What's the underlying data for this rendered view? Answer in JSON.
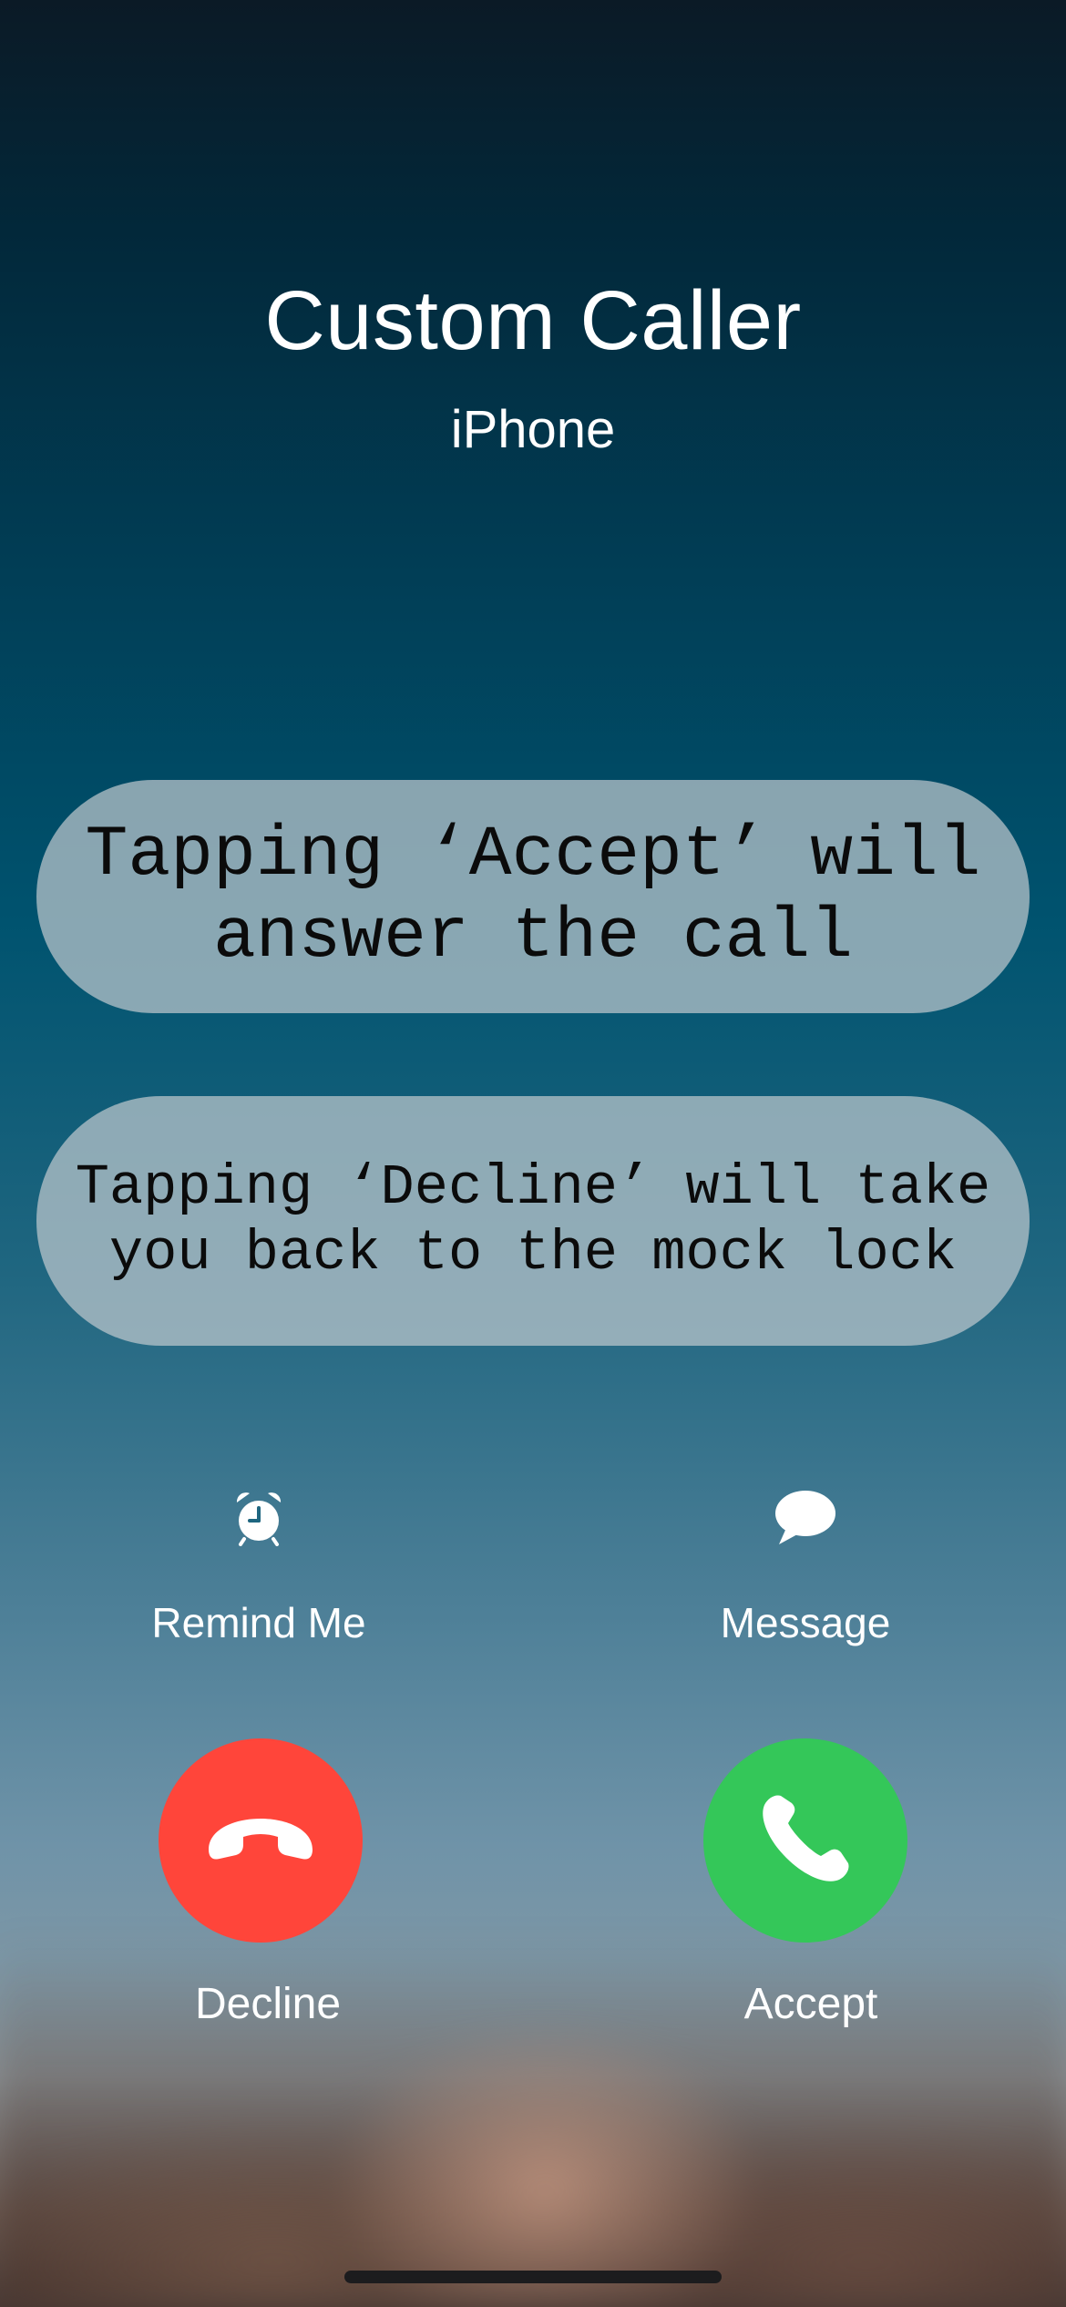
{
  "caller": {
    "name": "Custom Caller",
    "subtitle": "iPhone"
  },
  "banners": {
    "accept_hint": "Tapping ‘Accept’ will answer the call",
    "decline_hint": "Tapping ‘Decline’ will take you back to the mock lock"
  },
  "actions": {
    "remind": {
      "label": "Remind Me",
      "icon": "alarm-clock-icon"
    },
    "message": {
      "label": "Message",
      "icon": "message-bubble-icon"
    }
  },
  "call_buttons": {
    "decline": {
      "label": "Decline",
      "icon": "phone-down-icon",
      "color": "#ff453a"
    },
    "accept": {
      "label": "Accept",
      "icon": "phone-icon",
      "color": "#34c759"
    }
  }
}
